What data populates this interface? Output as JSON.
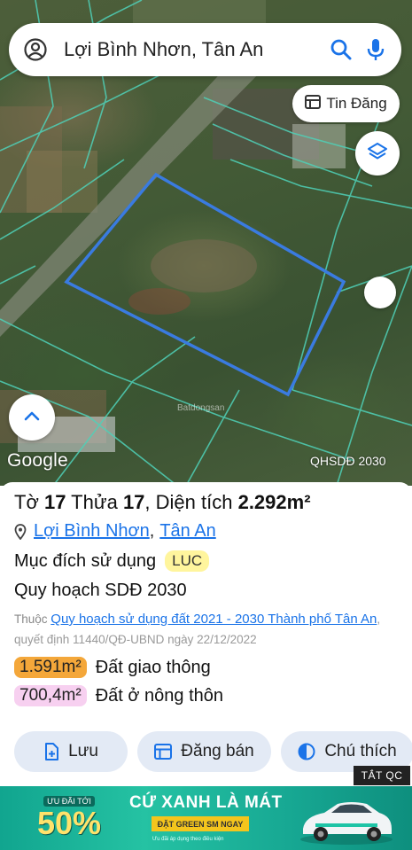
{
  "search": {
    "value": "Lợi Bình Nhơn, Tân An",
    "icons": [
      "account-icon",
      "search-icon",
      "mic-icon"
    ]
  },
  "map": {
    "tin_dang_label": "Tin Đăng",
    "logo": "Google",
    "label": "QHSDĐ 2030",
    "watermark": "Batdongsan",
    "colors": {
      "parcel_outline": "#3a7be0",
      "parcel_grid": "#4fd1b8"
    }
  },
  "parcel": {
    "title_prefix_1": "Tờ ",
    "sheet": "17",
    "title_prefix_2": " Thửa ",
    "plot": "17",
    "title_prefix_3": ", Diện tích ",
    "area": "2.292m²",
    "ward": "Lợi Bình Nhơn",
    "separator": ",",
    "city": "Tân An",
    "purpose_label": "Mục đích sử dụng",
    "purpose_code": "LUC",
    "plan_label": "Quy hoạch SDĐ 2030",
    "source_prefix": "Thuộc ",
    "source_link": "Quy hoạch sử dụng đất 2021 - 2030 Thành phố Tân An",
    "source_decision": ", quyết định 11440/QĐ-UBND ngày 22/12/2022",
    "zones": [
      {
        "area": "1.591m²",
        "label": "Đất giao thông",
        "color": "#f4a73a"
      },
      {
        "area": "700,4m²",
        "label": "Đất ở nông thôn",
        "color": "#f7d0f0"
      }
    ]
  },
  "actions": {
    "save": "Lưu",
    "post": "Đăng bán",
    "legend": "Chú thích"
  },
  "ad": {
    "close_label": "TẮT QC",
    "badge_top": "ƯU ĐÃI TỚI",
    "badge_percent": "50%",
    "badge_bottom": "",
    "headline": "CỨ XANH LÀ MÁT",
    "cta": "ĐẶT GREEN SM NGAY",
    "fine_print": "Ưu đãi áp dụng theo điều kiện"
  }
}
